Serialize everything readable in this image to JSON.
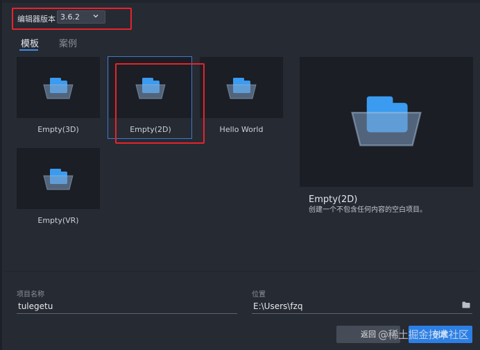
{
  "editor_version": {
    "label": "编辑器版本",
    "selected": "3.6.2"
  },
  "tabs": [
    {
      "label": "模板",
      "active": true
    },
    {
      "label": "案例",
      "active": false
    }
  ],
  "templates": [
    {
      "name": "Empty(3D)",
      "selected": false
    },
    {
      "name": "Empty(2D)",
      "selected": true
    },
    {
      "name": "Hello World",
      "selected": false
    },
    {
      "name": "Empty(VR)",
      "selected": false
    }
  ],
  "preview": {
    "title": "Empty(2D)",
    "description": "创建一个不包含任何内容的空白项目。"
  },
  "project_name": {
    "label": "项目名称",
    "value": "tulegetu"
  },
  "location": {
    "label": "位置",
    "value": "E:\\Users\\fzq"
  },
  "buttons": {
    "back": "返回",
    "create": "创建"
  },
  "watermark": "@稀土掘金技术社区",
  "colors": {
    "accent": "#2c7fe4",
    "annotation": "#e8232b",
    "folder": "#3a9bf0"
  },
  "icons": [
    "chevron-down-icon",
    "folder-icon",
    "browse-folder-icon"
  ]
}
